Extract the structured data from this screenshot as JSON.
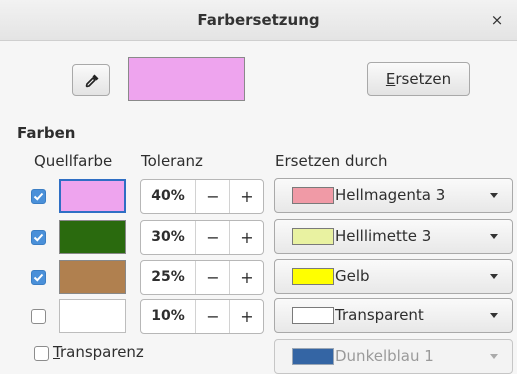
{
  "window": {
    "title": "Farbersetzung",
    "close_glyph": "×"
  },
  "toolbar": {
    "pipette_icon": "pipette-icon",
    "preview_color": "#eea4ee",
    "replace_label_mnemonic": "E",
    "replace_label_rest": "rsetzen"
  },
  "colors": {
    "section_label": "Farben",
    "headers": {
      "source": "Quellfarbe",
      "tolerance": "Toleranz",
      "replace_with": "Ersetzen durch"
    },
    "rows": [
      {
        "checked": true,
        "source_color": "#eea4ee",
        "source_selected": true,
        "tolerance": "40%",
        "minus": "−",
        "plus": "+",
        "replace_name": "Hellmagenta 3",
        "replace_color": "#f09aa6"
      },
      {
        "checked": true,
        "source_color": "#2a6a0e",
        "source_selected": false,
        "tolerance": "30%",
        "minus": "−",
        "plus": "+",
        "replace_name": "Helllimette 3",
        "replace_color": "#e9f2a1"
      },
      {
        "checked": true,
        "source_color": "#b0804f",
        "source_selected": false,
        "tolerance": "25%",
        "minus": "−",
        "plus": "+",
        "replace_name": "Gelb",
        "replace_color": "#ffff00"
      },
      {
        "checked": false,
        "source_color": "#ffffff",
        "source_selected": false,
        "tolerance": "10%",
        "minus": "−",
        "plus": "+",
        "replace_name": "Transparent",
        "replace_color": "#ffffff"
      }
    ]
  },
  "transparency": {
    "checked": false,
    "label_mnemonic": "T",
    "label_rest": "ransparenz",
    "replace_name": "Dunkelblau 1",
    "replace_color": "#3465a4",
    "enabled": false
  }
}
